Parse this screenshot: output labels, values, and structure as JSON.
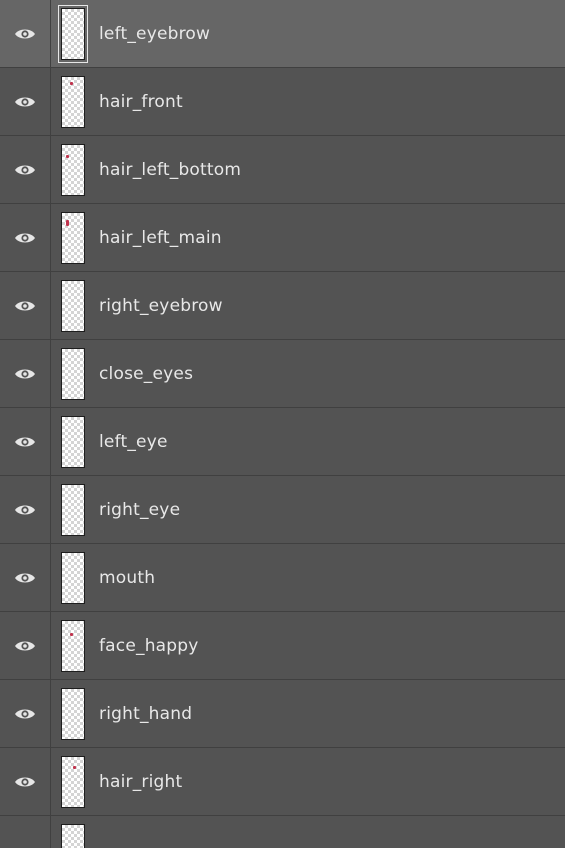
{
  "layers": [
    {
      "name": "left_eyebrow",
      "visible": true,
      "selected": true
    },
    {
      "name": "hair_front",
      "visible": true,
      "selected": false
    },
    {
      "name": "hair_left_bottom",
      "visible": true,
      "selected": false
    },
    {
      "name": "hair_left_main",
      "visible": true,
      "selected": false
    },
    {
      "name": "right_eyebrow",
      "visible": true,
      "selected": false
    },
    {
      "name": "close_eyes",
      "visible": true,
      "selected": false
    },
    {
      "name": "left_eye",
      "visible": true,
      "selected": false
    },
    {
      "name": "right_eye",
      "visible": true,
      "selected": false
    },
    {
      "name": "mouth",
      "visible": true,
      "selected": false
    },
    {
      "name": "face_happy",
      "visible": true,
      "selected": false
    },
    {
      "name": "right_hand",
      "visible": true,
      "selected": false
    },
    {
      "name": "hair_right",
      "visible": true,
      "selected": false
    }
  ],
  "icons": {
    "visibility": "eye-icon",
    "thumbnail": "layer-thumbnail"
  },
  "colors": {
    "panel_bg": "#535353",
    "selected_bg": "#666666",
    "divider": "#404040",
    "text": "#e8e8e8",
    "thumb_mark": "#c0334d"
  }
}
